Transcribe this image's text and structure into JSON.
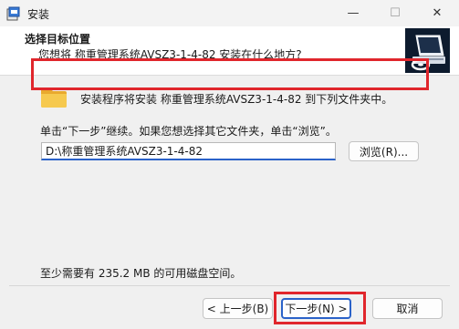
{
  "window": {
    "title": "安装"
  },
  "title_buttons": {
    "minimize": "—",
    "maximize": "☐",
    "close": "✕"
  },
  "header": {
    "title": "选择目标位置",
    "subtitle": "您想将 称重管理系统AVSZ3-1-4-82 安装在什么地方?"
  },
  "body": {
    "info_text": "安装程序将安装 称重管理系统AVSZ3-1-4-82 到下列文件夹中。",
    "instruction_text": "单击“下一步”继续。如果您想选择其它文件夹，单击“浏览”。",
    "path_value": "D:\\称重管理系统AVSZ3-1-4-82",
    "browse_label": "浏览(R)...",
    "space_text": "至少需要有 235.2 MB 的可用磁盘空间。"
  },
  "footer": {
    "back_label": "< 上一步(B)",
    "next_label": "下一步(N) >",
    "cancel_label": "取消"
  },
  "colors": {
    "highlight": "#e0262c",
    "accent": "#2a62c9",
    "folder": "#f2c14e"
  },
  "icons": [
    "setup-app-icon",
    "folder-icon",
    "computer-disk-icon"
  ]
}
